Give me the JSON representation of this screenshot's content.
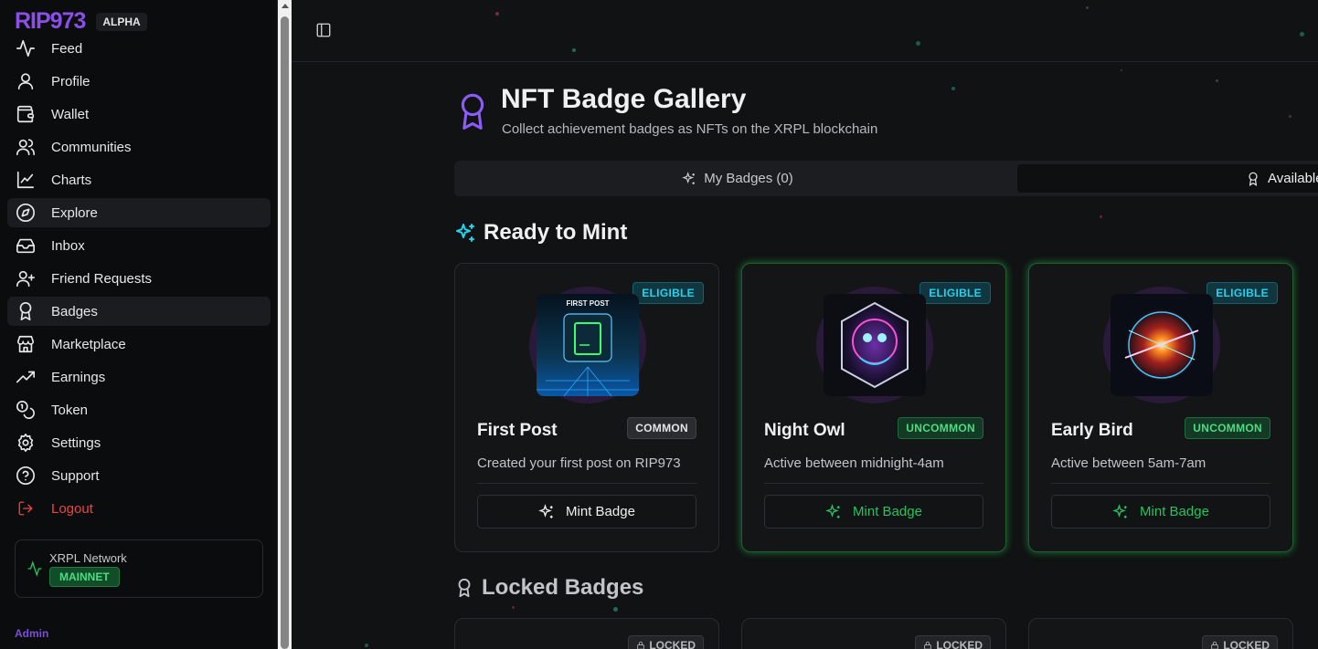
{
  "brand": {
    "logo": "RIP973",
    "tag": "ALPHA"
  },
  "sidebar": {
    "items": [
      {
        "label": "Feed",
        "icon": "activity-icon"
      },
      {
        "label": "Profile",
        "icon": "user-icon"
      },
      {
        "label": "Wallet",
        "icon": "wallet-icon"
      },
      {
        "label": "Communities",
        "icon": "users-icon"
      },
      {
        "label": "Charts",
        "icon": "chart-line-icon"
      },
      {
        "label": "Explore",
        "icon": "compass-icon"
      },
      {
        "label": "Inbox",
        "icon": "inbox-icon"
      },
      {
        "label": "Friend Requests",
        "icon": "user-plus-icon"
      },
      {
        "label": "Badges",
        "icon": "award-icon"
      },
      {
        "label": "Marketplace",
        "icon": "store-icon"
      },
      {
        "label": "Earnings",
        "icon": "trending-up-icon"
      },
      {
        "label": "Token",
        "icon": "coins-icon"
      },
      {
        "label": "Settings",
        "icon": "gear-icon"
      },
      {
        "label": "Support",
        "icon": "help-circle-icon"
      },
      {
        "label": "Logout",
        "icon": "logout-icon"
      }
    ],
    "network": {
      "label": "XRPL Network",
      "status": "MAINNET"
    },
    "admin_label": "Admin"
  },
  "page": {
    "title": "NFT Badge Gallery",
    "subtitle": "Collect achievement badges as NFTs on the XRPL blockchain"
  },
  "tabs": [
    {
      "label": "My Badges (0)"
    },
    {
      "label": "Available"
    }
  ],
  "sections": {
    "ready": "Ready to Mint",
    "locked": "Locked Badges"
  },
  "ready_badges": [
    {
      "status": "ELIGIBLE",
      "art_text": "FIRST POST",
      "name": "First Post",
      "rarity": "COMMON",
      "description": "Created your first post on RIP973",
      "button": "Mint Badge"
    },
    {
      "status": "ELIGIBLE",
      "name": "Night Owl",
      "rarity": "UNCOMMON",
      "description": "Active between midnight-4am",
      "button": "Mint Badge"
    },
    {
      "status": "ELIGIBLE",
      "name": "Early Bird",
      "rarity": "UNCOMMON",
      "description": "Active between 5am-7am",
      "button": "Mint Badge"
    }
  ],
  "locked_badges": [
    {
      "status": "LOCKED"
    },
    {
      "status": "LOCKED"
    },
    {
      "status": "LOCKED"
    }
  ],
  "colors": {
    "accent": "#8b5cf6",
    "success": "#22c55e",
    "cyan": "#22d3ee",
    "danger": "#ef4444"
  }
}
